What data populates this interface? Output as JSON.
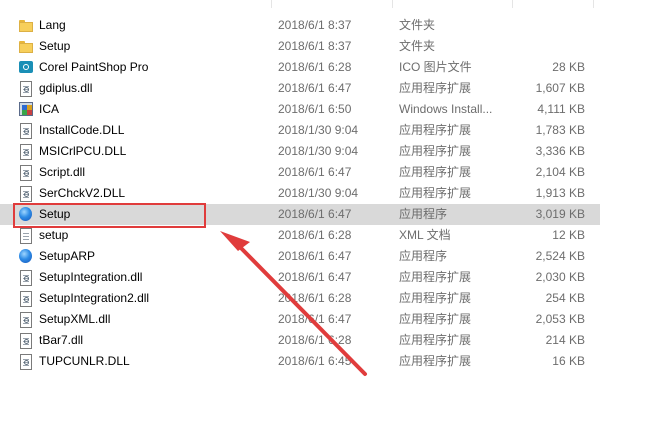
{
  "files": [
    {
      "name": "Lang",
      "date": "2018/6/1 8:37",
      "type": "文件夹",
      "size": "",
      "icon": "folder-icon"
    },
    {
      "name": "Setup",
      "date": "2018/6/1 8:37",
      "type": "文件夹",
      "size": "",
      "icon": "folder-icon"
    },
    {
      "name": "Corel PaintShop Pro",
      "date": "2018/6/1 6:28",
      "type": "ICO 图片文件",
      "size": "28 KB",
      "icon": "ico-image-icon"
    },
    {
      "name": "gdiplus.dll",
      "date": "2018/6/1 6:47",
      "type": "应用程序扩展",
      "size": "1,607 KB",
      "icon": "dll-file-icon"
    },
    {
      "name": "ICA",
      "date": "2018/6/1 6:50",
      "type": "Windows Install...",
      "size": "4,111 KB",
      "icon": "msi-installer-icon"
    },
    {
      "name": "InstallCode.DLL",
      "date": "2018/1/30 9:04",
      "type": "应用程序扩展",
      "size": "1,783 KB",
      "icon": "dll-file-icon"
    },
    {
      "name": "MSICrlPCU.DLL",
      "date": "2018/1/30 9:04",
      "type": "应用程序扩展",
      "size": "3,336 KB",
      "icon": "dll-file-icon"
    },
    {
      "name": "Script.dll",
      "date": "2018/6/1 6:47",
      "type": "应用程序扩展",
      "size": "2,104 KB",
      "icon": "dll-file-icon"
    },
    {
      "name": "SerChckV2.DLL",
      "date": "2018/1/30 9:04",
      "type": "应用程序扩展",
      "size": "1,913 KB",
      "icon": "dll-file-icon"
    },
    {
      "name": "Setup",
      "date": "2018/6/1 6:47",
      "type": "应用程序",
      "size": "3,019 KB",
      "icon": "setup-exe-icon",
      "selected": true
    },
    {
      "name": "setup",
      "date": "2018/6/1 6:28",
      "type": "XML 文档",
      "size": "12 KB",
      "icon": "xml-document-icon"
    },
    {
      "name": "SetupARP",
      "date": "2018/6/1 6:47",
      "type": "应用程序",
      "size": "2,524 KB",
      "icon": "setup-exe-icon"
    },
    {
      "name": "SetupIntegration.dll",
      "date": "2018/6/1 6:47",
      "type": "应用程序扩展",
      "size": "2,030 KB",
      "icon": "dll-file-icon"
    },
    {
      "name": "SetupIntegration2.dll",
      "date": "2018/6/1 6:28",
      "type": "应用程序扩展",
      "size": "254 KB",
      "icon": "dll-file-icon"
    },
    {
      "name": "SetupXML.dll",
      "date": "2018/6/1 6:47",
      "type": "应用程序扩展",
      "size": "2,053 KB",
      "icon": "dll-file-icon"
    },
    {
      "name": "tBar7.dll",
      "date": "2018/6/1 6:28",
      "type": "应用程序扩展",
      "size": "214 KB",
      "icon": "dll-file-icon"
    },
    {
      "name": "TUPCUNLR.DLL",
      "date": "2018/6/1 6:45",
      "type": "应用程序扩展",
      "size": "16 KB",
      "icon": "dll-file-icon"
    }
  ],
  "annotation": {
    "highlight_color": "#e03c3c",
    "target": "Setup"
  },
  "colors": {
    "selected_row": "#d9d9d9",
    "secondary_text": "#6d6d6d"
  }
}
